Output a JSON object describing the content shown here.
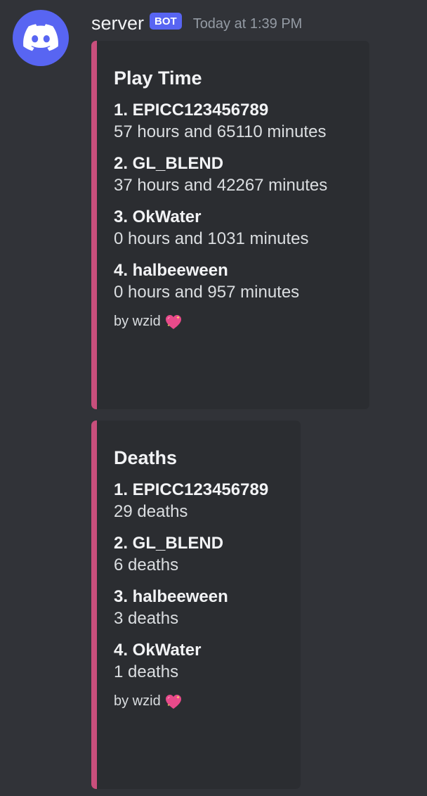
{
  "message": {
    "username": "server",
    "bot_tag": "BOT",
    "timestamp": "Today at 1:39 PM"
  },
  "embeds": [
    {
      "title": "Play Time",
      "accent_color": "#c94f7c",
      "fields": [
        {
          "name": "1. EPICC123456789",
          "value": "57 hours and 65110 minutes"
        },
        {
          "name": "2. GL_BLEND",
          "value": "37 hours and 42267 minutes"
        },
        {
          "name": "3. OkWater",
          "value": "0 hours and 1031 minutes"
        },
        {
          "name": "4. halbeeween",
          "value": "0 hours and 957 minutes"
        }
      ],
      "footer": "by wzid",
      "footer_icon": "sparkling-heart-icon"
    },
    {
      "title": "Deaths",
      "accent_color": "#c94f7c",
      "fields": [
        {
          "name": "1. EPICC123456789",
          "value": "29 deaths"
        },
        {
          "name": "2. GL_BLEND",
          "value": "6 deaths"
        },
        {
          "name": "3. halbeeween",
          "value": "3 deaths"
        },
        {
          "name": "4. OkWater",
          "value": "1 deaths"
        }
      ],
      "footer": "by wzid",
      "footer_icon": "sparkling-heart-icon"
    }
  ],
  "avatar_icon": "discord-logo-icon",
  "colors": {
    "background": "#313338",
    "embed_background": "#2b2d31",
    "bot_tag": "#5865f2"
  }
}
